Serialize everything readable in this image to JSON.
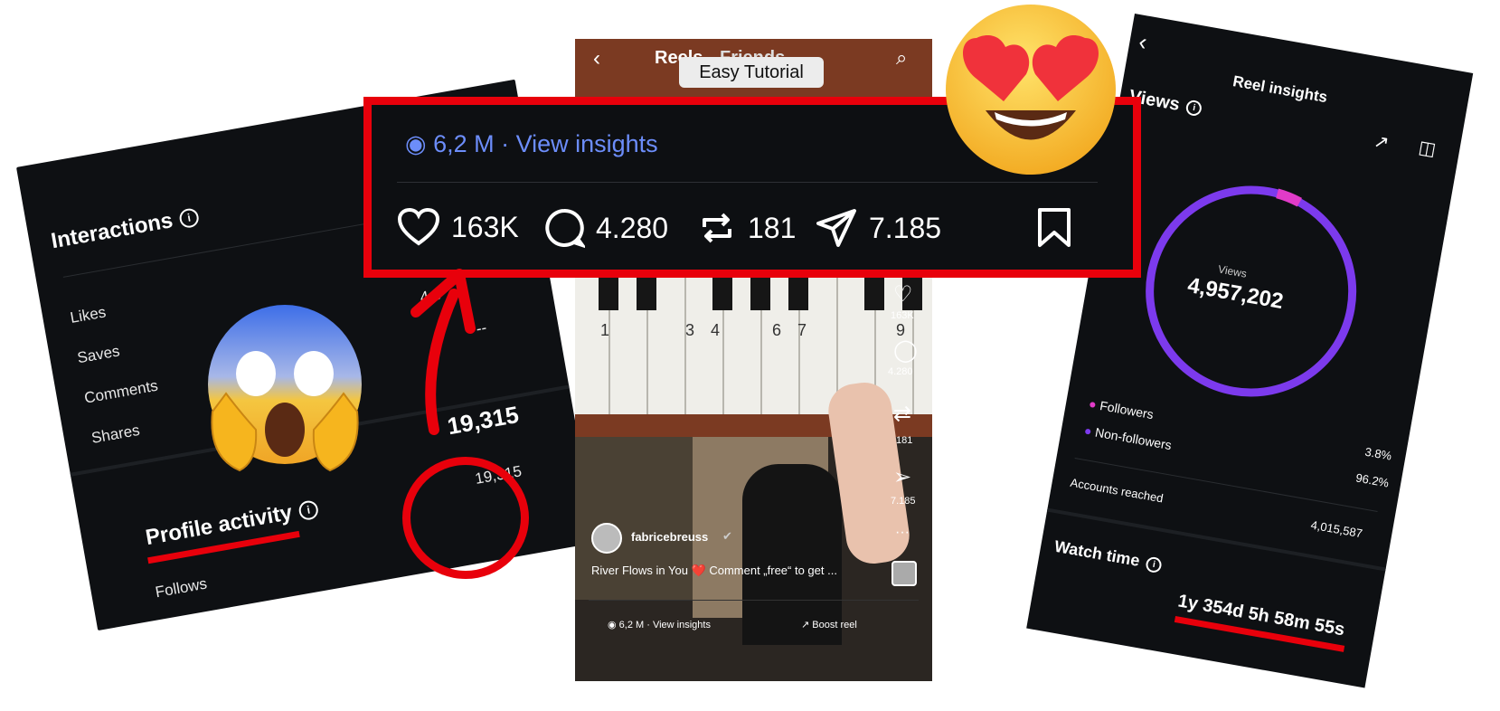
{
  "left_card": {
    "interactions_title": "Interactions",
    "items": [
      "Likes",
      "Saves",
      "Comments",
      "Shares"
    ],
    "partial_values": [
      "7",
      "4 0",
      "--"
    ],
    "interactions_total": "19,315",
    "profile_activity_title": "Profile activity",
    "profile_activity_value": "19,315",
    "follows_label": "Follows"
  },
  "phone": {
    "tab_reels": "Reels",
    "tab_friends": "Friends",
    "video_caption_label": "Easy Tutorial",
    "key_numbers": [
      "1",
      "3",
      "4",
      "6",
      "7",
      "9"
    ],
    "side_counts": {
      "likes": "163K",
      "comments": "4.280",
      "reposts": "181",
      "shares": "7.185"
    },
    "username": "fabricebreuss",
    "caption": "River Flows in You ❤️ Comment „free“ to get ...",
    "bottom_insights": "6,2 M · View insights",
    "boost": "Boost reel"
  },
  "overlay": {
    "views_insights": "6,2 M · View insights",
    "likes": "163K",
    "comments": "4.280",
    "reposts": "181",
    "shares": "7.185"
  },
  "right_card": {
    "title": "Reel insights",
    "views_label": "Views",
    "donut_label": "Views",
    "donut_value": "4,957,202",
    "followers_label": "Followers",
    "non_followers_label": "Non-followers",
    "followers_pct": "3.8%",
    "non_followers_pct": "96.2%",
    "accounts_reached_label": "Accounts reached",
    "accounts_reached_value": "4,015,587",
    "watch_time_label": "Watch time",
    "watch_time_value": "1y 354d 5h 58m 55s",
    "followers_fraction": 0.038
  },
  "colors": {
    "accent_red": "#e8000b",
    "link_blue": "#6c8dfa",
    "donut_purple": "#7c3aed",
    "donut_pink": "#e13bc8",
    "card_bg": "#0e1013"
  }
}
